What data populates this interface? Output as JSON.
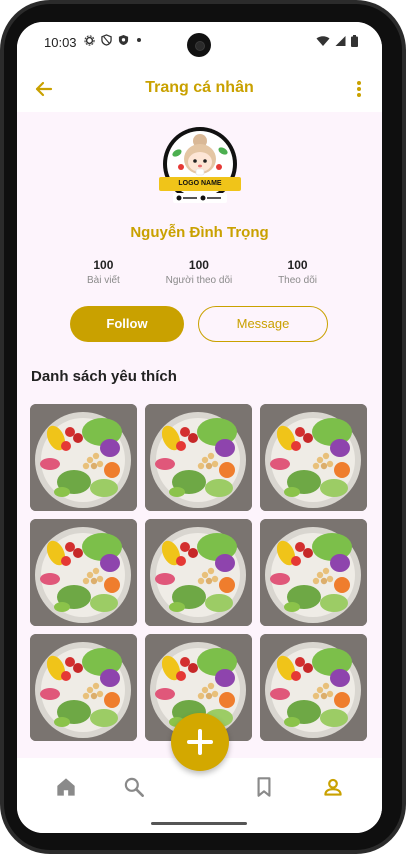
{
  "status": {
    "time": "10:03",
    "left_icons": [
      "gear-icon",
      "shield-icon",
      "shield-filled-icon",
      "dot-icon"
    ],
    "right_icons": [
      "wifi-icon",
      "signal-icon",
      "battery-icon"
    ]
  },
  "appbar": {
    "title": "Trang cá nhân",
    "back_icon": "arrow-left-icon",
    "more_icon": "more-vertical-icon"
  },
  "profile": {
    "logo_text": "LOGO NAME",
    "name": "Nguyễn Đình Trọng",
    "stats": [
      {
        "value": "100",
        "label": "Bài viết"
      },
      {
        "value": "100",
        "label": "Người theo dõi"
      },
      {
        "value": "100",
        "label": "Theo dõi"
      }
    ],
    "follow_label": "Follow",
    "message_label": "Message"
  },
  "favorites": {
    "title": "Danh sách yêu thích",
    "items": [
      "salad",
      "salad",
      "salad",
      "salad",
      "salad",
      "salad",
      "salad",
      "salad",
      "salad"
    ]
  },
  "bottom_nav": {
    "items": [
      "home-icon",
      "search-icon",
      "bookmark-icon",
      "person-icon"
    ],
    "active": "person-icon",
    "fab_icon": "plus-icon"
  },
  "colors": {
    "accent": "#c9a100",
    "background": "#fdf4fc"
  }
}
